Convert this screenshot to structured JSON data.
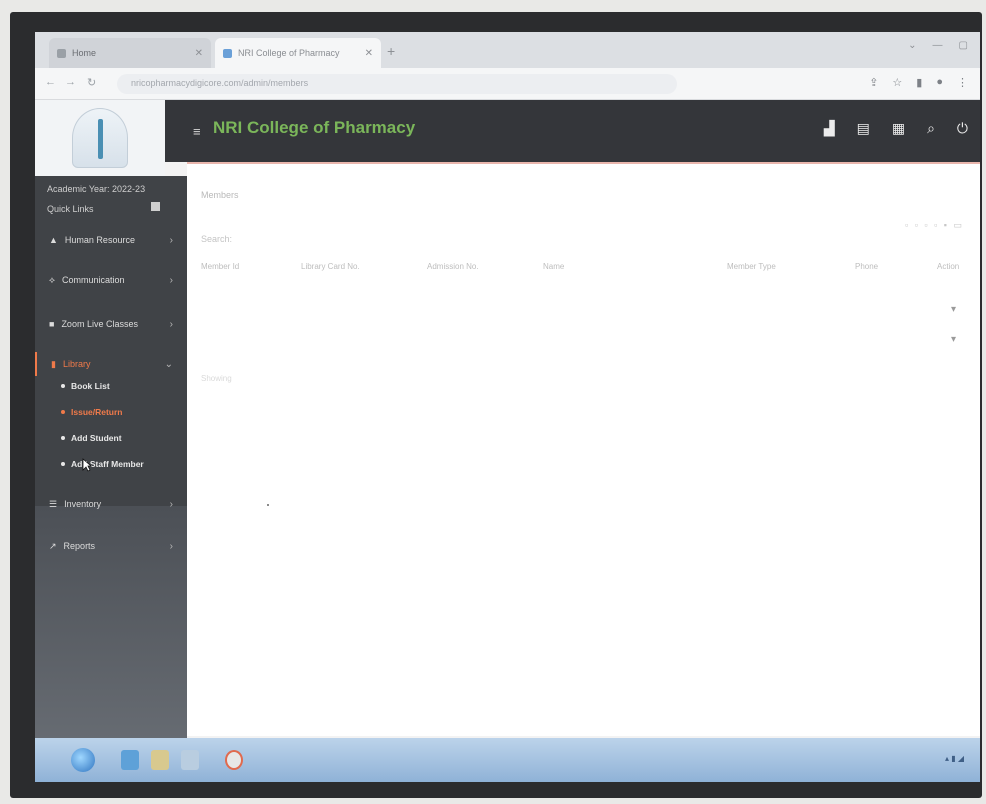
{
  "browser": {
    "tabs": [
      {
        "label": "Home"
      },
      {
        "label": "NRI College of Pharmacy"
      }
    ],
    "url": "nricopharmacydigicore.com/admin/members"
  },
  "app": {
    "brand": "NRI College of Pharmacy",
    "brand_color": "#7bb65a",
    "accent_color": "#f07a4a"
  },
  "sidebar": {
    "academic_year": "Academic Year: 2022-23",
    "quick_links": "Quick Links",
    "items": [
      {
        "label": "Human Resource"
      },
      {
        "label": "Communication"
      },
      {
        "label": "Zoom Live Classes"
      },
      {
        "label": "Library"
      },
      {
        "label": "Inventory"
      },
      {
        "label": "Reports"
      }
    ],
    "library_sub": [
      {
        "label": "Book List"
      },
      {
        "label": "Issue/Return"
      },
      {
        "label": "Add Student"
      },
      {
        "label": "Add Staff Member"
      }
    ]
  },
  "content": {
    "title": "Members",
    "search_label": "Search:",
    "columns": [
      "Member Id",
      "Library Card No.",
      "Admission No.",
      "Name",
      "Member Type",
      "Phone",
      "Action"
    ],
    "footer": "Showing"
  }
}
